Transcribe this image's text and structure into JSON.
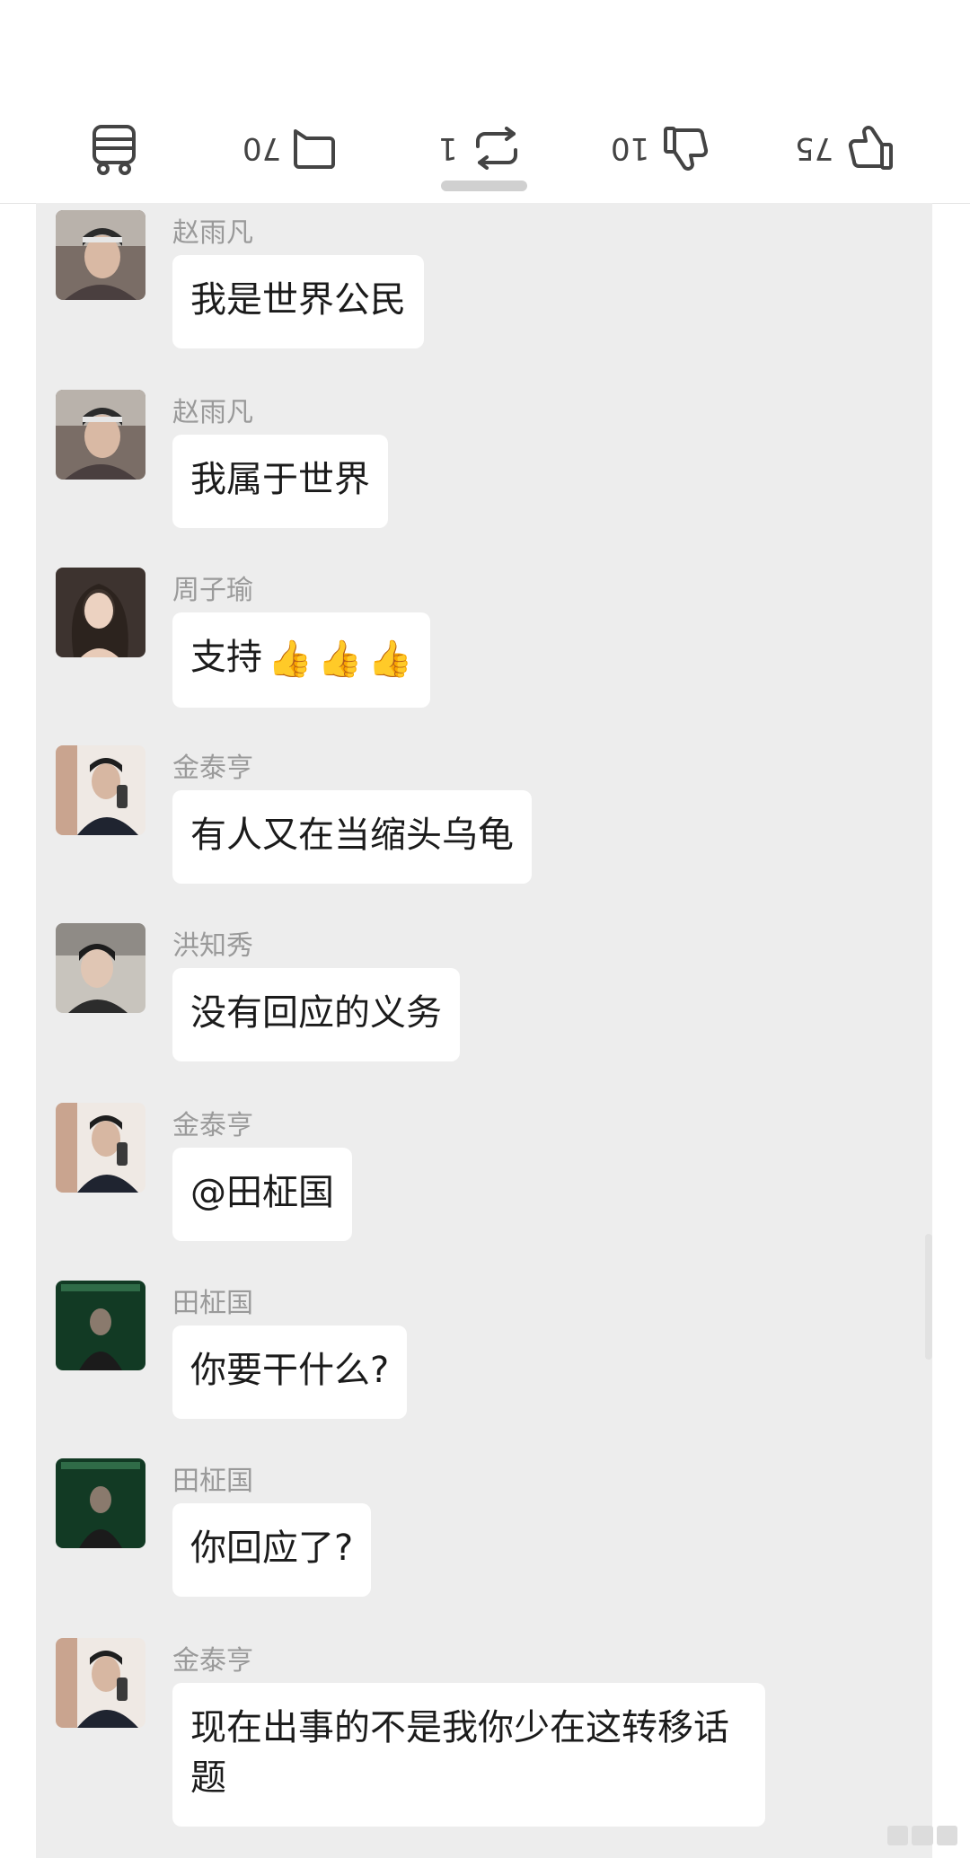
{
  "action_bar": {
    "like_count": "75",
    "dislike_count": "10",
    "repost_count": "1",
    "comment_count": "70"
  },
  "messages": [
    {
      "sender": "赵雨凡",
      "text": "我是世界公民",
      "avatar_icon": "user-avatar-icon"
    },
    {
      "sender": "赵雨凡",
      "text": "我属于世界",
      "avatar_icon": "user-avatar-icon"
    },
    {
      "sender": "周子瑜",
      "text": "支持",
      "avatar_icon": "user-avatar-icon",
      "emoji": [
        "👍",
        "👍",
        "👍"
      ]
    },
    {
      "sender": "金泰亨",
      "text": "有人又在当缩头乌龟",
      "avatar_icon": "user-avatar-icon"
    },
    {
      "sender": "洪知秀",
      "text": "没有回应的义务",
      "avatar_icon": "user-avatar-icon"
    },
    {
      "sender": "金泰亨",
      "text": "@田柾国",
      "avatar_icon": "user-avatar-icon"
    },
    {
      "sender": "田柾国",
      "text": "你要干什么?",
      "avatar_icon": "album-avatar-icon"
    },
    {
      "sender": "田柾国",
      "text": "你回应了?",
      "avatar_icon": "album-avatar-icon"
    },
    {
      "sender": "金泰亨",
      "text": "现在出事的不是我你少在这转移话题",
      "avatar_icon": "user-avatar-icon"
    }
  ],
  "colors": {
    "chat_background": "#ededed",
    "bubble": "#ffffff",
    "sender_name": "#9a9a9a"
  }
}
